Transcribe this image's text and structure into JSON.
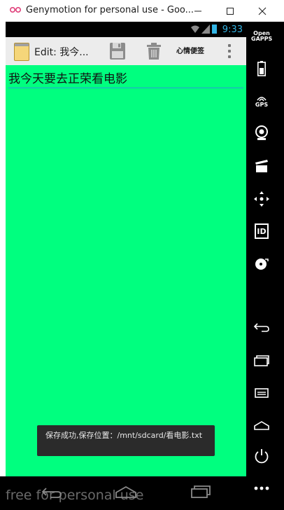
{
  "window": {
    "title": "Genymotion for personal use - Goo...",
    "minimize_icon": "minimize-icon",
    "maximize_icon": "maximize-icon",
    "close_icon": "close-icon"
  },
  "status_bar": {
    "time": "9:33",
    "icons": [
      "wifi-icon",
      "signal-icon",
      "battery-icon"
    ],
    "accent_color": "#33b5e5"
  },
  "action_bar": {
    "title": "Edit: 我今...",
    "save_icon": "save-icon",
    "delete_icon": "trash-icon",
    "mood_button": "心情便签",
    "overflow_icon": "overflow-menu-icon"
  },
  "editor": {
    "text": "我今天要去正荣看电影",
    "background_color": "#00ff7f"
  },
  "toast": {
    "message": "保存成功,保存位置：/mnt/sdcard/看电影.txt"
  },
  "side_panel": {
    "items": [
      {
        "label": "Open GAPPS",
        "icon": "opengapps-icon"
      },
      {
        "label": "",
        "icon": "battery-icon"
      },
      {
        "label": "GPS",
        "icon": "gps-icon"
      },
      {
        "label": "",
        "icon": "camera-icon"
      },
      {
        "label": "",
        "icon": "media-clapperboard-icon"
      },
      {
        "label": "",
        "icon": "dpad-move-icon"
      },
      {
        "label": "ID",
        "icon": "id-icon"
      },
      {
        "label": "",
        "icon": "disk-icon"
      },
      {
        "label": "",
        "icon": "back-icon"
      },
      {
        "label": "",
        "icon": "recent-apps-icon"
      },
      {
        "label": "",
        "icon": "menu-icon"
      },
      {
        "label": "",
        "icon": "home-icon"
      },
      {
        "label": "",
        "icon": "power-icon"
      },
      {
        "label": "",
        "icon": "more-icon"
      }
    ]
  },
  "bottom_bar": {
    "watermark": "free for personal use",
    "nav_icons": [
      "back-icon",
      "home-icon",
      "recent-apps-icon"
    ]
  }
}
